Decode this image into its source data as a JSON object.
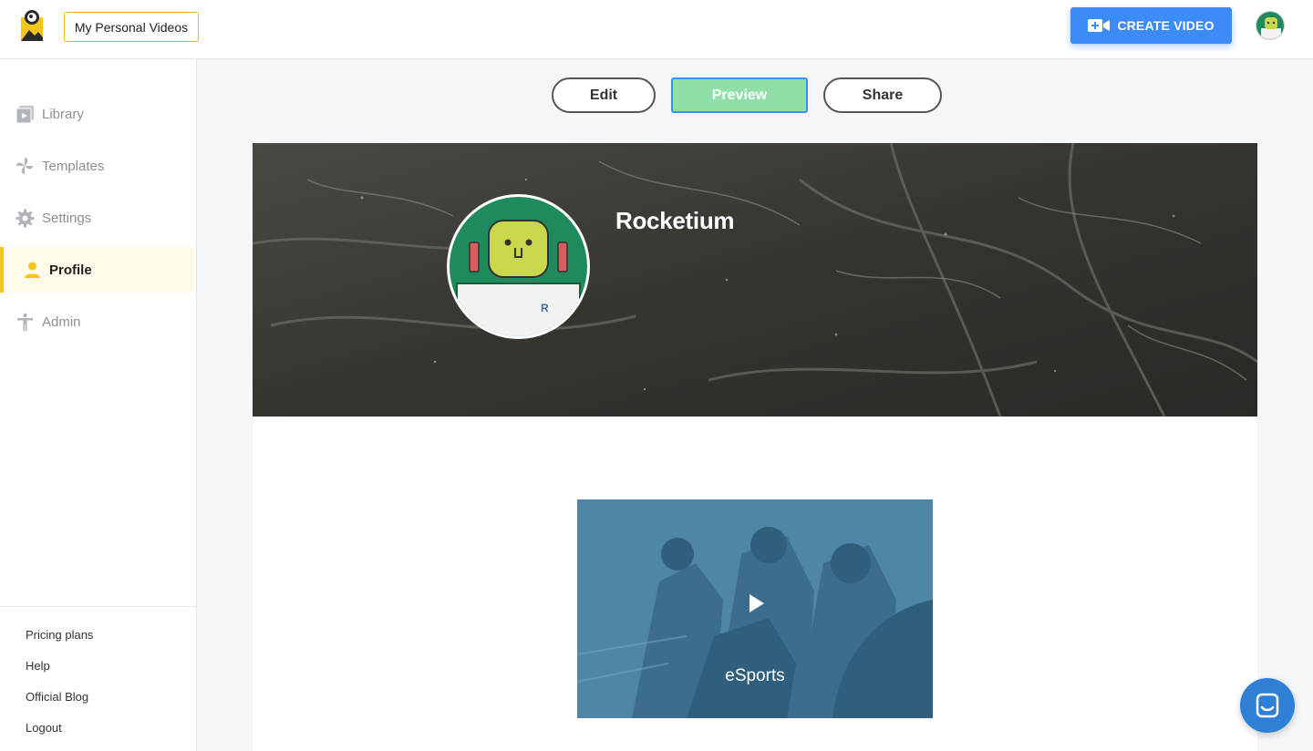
{
  "header": {
    "workspace_label": "My Personal Videos",
    "create_button_label": "CREATE VIDEO"
  },
  "sidebar": {
    "items": [
      {
        "label": "Library",
        "icon": "library-icon"
      },
      {
        "label": "Templates",
        "icon": "templates-icon"
      },
      {
        "label": "Settings",
        "icon": "gear-icon"
      },
      {
        "label": "Profile",
        "icon": "person-icon",
        "active": true
      },
      {
        "label": "Admin",
        "icon": "admin-icon"
      }
    ],
    "footer_links": [
      "Pricing plans",
      "Help",
      "Official Blog",
      "Logout"
    ]
  },
  "tabs": {
    "edit": "Edit",
    "preview": "Preview",
    "share": "Share",
    "active": "preview"
  },
  "profile": {
    "name": "Rocketium"
  },
  "videos": [
    {
      "title": "eSports"
    }
  ],
  "colors": {
    "accent": "#3d8bf7",
    "brand_yellow": "#f5c518",
    "preview_green": "#8ee0a8",
    "chat_blue": "#2f7fd6"
  }
}
